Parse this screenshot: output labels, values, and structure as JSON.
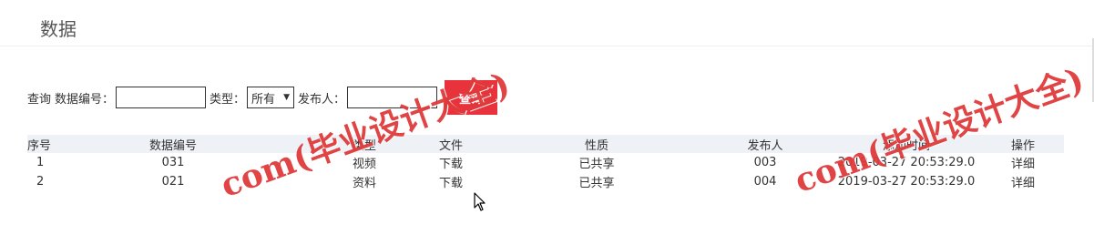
{
  "page": {
    "title": "数据"
  },
  "search": {
    "label_query": "查询",
    "label_code": "数据编号：",
    "code_value": "",
    "label_type": "类型：",
    "type_selected": "所有",
    "label_publisher": "发布人：",
    "publisher_value": "",
    "button_label": "查询"
  },
  "table": {
    "headers": [
      "序号",
      "数据编号",
      "类型",
      "文件",
      "性质",
      "发布人",
      "添加时间",
      "操作"
    ],
    "rows": [
      {
        "index": "1",
        "code": "031",
        "type": "视频",
        "file": "下载",
        "nature": "已共享",
        "publisher": "003",
        "time": "2019-03-27 20:53:29.0",
        "action": "详细"
      },
      {
        "index": "2",
        "code": "021",
        "type": "资料",
        "file": "下载",
        "nature": "已共享",
        "publisher": "004",
        "time": "2019-03-27 20:53:29.0",
        "action": "详细"
      }
    ]
  },
  "watermark": {
    "text": "com(毕业设计大全)"
  },
  "colors": {
    "accent": "#e8323c",
    "header_bg": "#eef1f6",
    "watermark": "#e03a3a"
  },
  "icons": {
    "select_arrow": "chevron-down-icon",
    "cursor": "mouse-pointer-icon"
  }
}
